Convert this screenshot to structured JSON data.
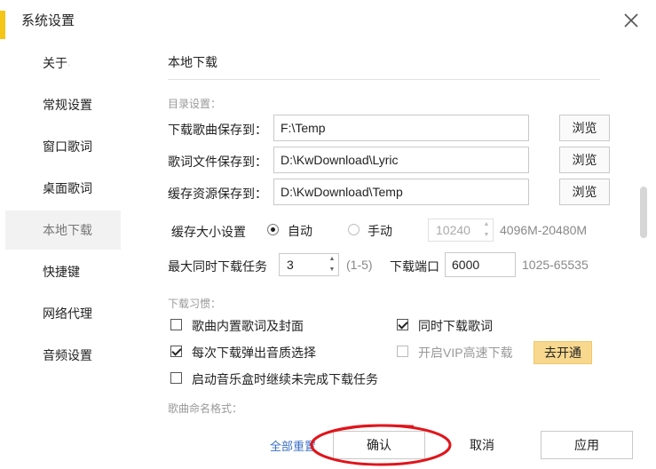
{
  "window": {
    "title": "系统设置"
  },
  "sidebar": {
    "items": [
      {
        "label": "关于",
        "dot": "·"
      },
      {
        "label": "常规设置"
      },
      {
        "label": "窗口歌词"
      },
      {
        "label": "桌面歌词"
      },
      {
        "label": "本地下载",
        "active": true
      },
      {
        "label": "快捷键"
      },
      {
        "label": "网络代理"
      },
      {
        "label": "音频设置"
      }
    ]
  },
  "content": {
    "title": "本地下载",
    "dir_group": "目录设置：",
    "dirs": [
      {
        "label": "下载歌曲保存到：",
        "value": "F:\\Temp",
        "button": "浏览"
      },
      {
        "label": "歌词文件保存到：",
        "value": "D:\\KwDownload\\Lyric",
        "button": "浏览"
      },
      {
        "label": "缓存资源保存到：",
        "value": "D:\\KwDownload\\Temp",
        "button": "浏览"
      }
    ],
    "cache": {
      "label": "缓存大小设置",
      "auto": "自动",
      "manual": "手动",
      "size_value": "10240",
      "range": "4096M-20480M"
    },
    "tasks": {
      "label": "最大同时下载任务",
      "value": "3",
      "range": "(1-5)",
      "port_label": "下载端口",
      "port_value": "6000",
      "port_range": "1025-65535"
    },
    "habits_group": "下载习惯：",
    "habits": {
      "embed_lyrics": "歌曲内置歌词及封面",
      "download_lyrics": "同时下载歌词",
      "quality_popup": "每次下载弹出音质选择",
      "vip_speed": "开启VIP高速下载",
      "vip_button": "去开通",
      "resume": "启动音乐盒时继续未完成下载任务"
    },
    "naming_group": "歌曲命名格式："
  },
  "footer": {
    "reset": "全部重置",
    "confirm": "确认",
    "cancel": "取消",
    "apply": "应用"
  },
  "colors": {
    "annotation_circle": "#e0151b",
    "vip_button": "#f7d88e",
    "reset_link": "#3a6fc4"
  }
}
